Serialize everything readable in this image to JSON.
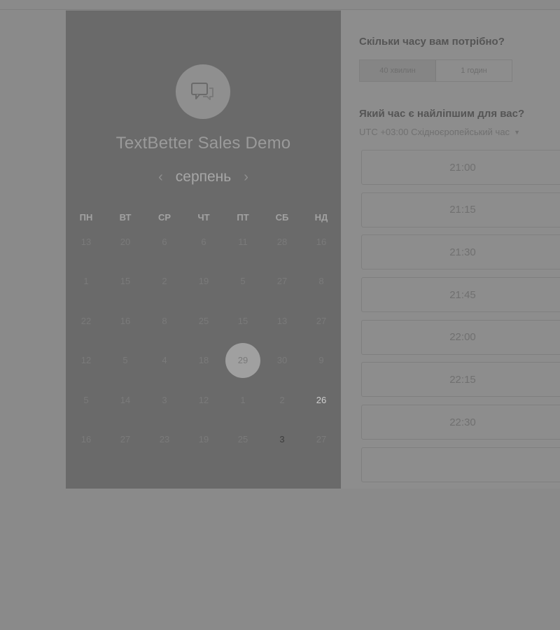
{
  "event": {
    "title": "TextBetter Sales Demo",
    "logo_icon": "chat-bubbles-icon"
  },
  "calendar": {
    "month": "серпень",
    "prev_icon": "chevron-left-icon",
    "next_icon": "chevron-right-icon",
    "weekdays": [
      "ПН",
      "ВТ",
      "СР",
      "ЧТ",
      "ПТ",
      "СБ",
      "НД"
    ],
    "weeks": [
      [
        "13",
        "20",
        "6",
        "6",
        "11",
        "28",
        "16"
      ],
      [
        "1",
        "15",
        "2",
        "19",
        "5",
        "27",
        "8"
      ],
      [
        "22",
        "16",
        "8",
        "25",
        "15",
        "13",
        "27"
      ],
      [
        "12",
        "5",
        "4",
        "18",
        "29",
        "30",
        "9"
      ],
      [
        "5",
        "14",
        "3",
        "12",
        "1",
        "2",
        "26"
      ],
      [
        "16",
        "27",
        "23",
        "19",
        "25",
        "3",
        "27"
      ]
    ],
    "highlighted_day": "29"
  },
  "booking": {
    "duration_question": "Скільки часу вам потрібно?",
    "durations": [
      "40 хвилин",
      "1 годин"
    ],
    "time_question": "Який час є найліпшим для вас?",
    "timezone": "UTC +03:00 Східноєропейський час",
    "slots": [
      "21:00",
      "21:15",
      "21:30",
      "21:45",
      "22:00",
      "22:15",
      "22:30",
      ""
    ]
  }
}
